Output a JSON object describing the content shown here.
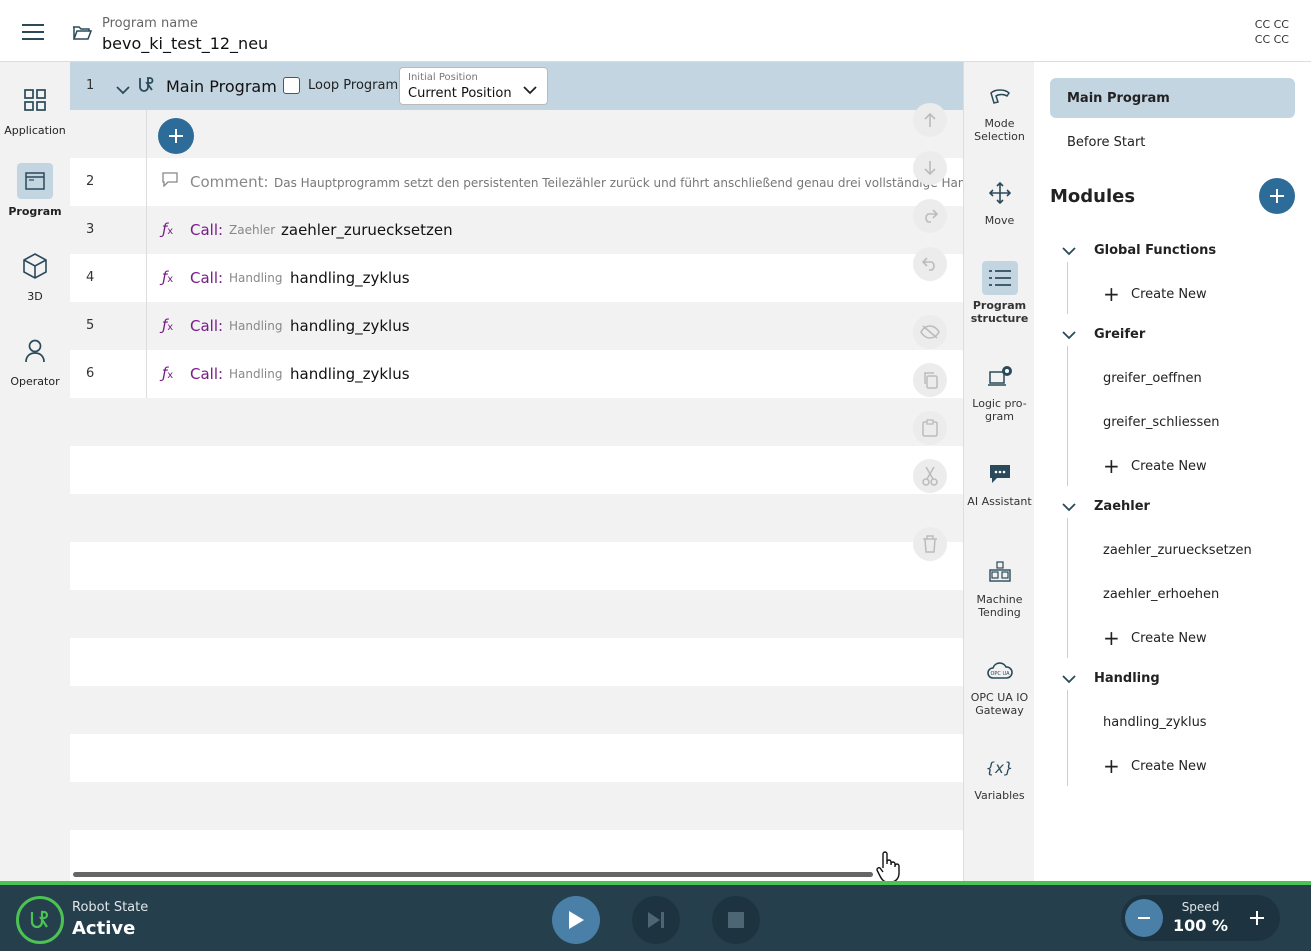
{
  "header": {
    "program_label": "Program name",
    "program_name": "bevo_ki_test_12_neu",
    "cc_top": "CC CC",
    "cc_bottom": "CC CC"
  },
  "leftnav": [
    {
      "label": "Application",
      "icon": "grid-icon"
    },
    {
      "label": "Program",
      "icon": "program-window-icon",
      "active": true
    },
    {
      "label": "3D",
      "icon": "cube-icon"
    },
    {
      "label": "Operator",
      "icon": "person-icon"
    }
  ],
  "program": {
    "row1": {
      "num": "1",
      "title": "Main Program",
      "loop_label": "Loop Program",
      "initpos_label": "Initial Position",
      "initpos_value": "Current Position"
    },
    "rows": [
      {
        "num": "2",
        "kind": "comment",
        "keyword": "Comment:",
        "text": "Das Hauptprogramm setzt den persistenten Teilezähler zurück und führt anschließend genau drei vollständige Handlin"
      },
      {
        "num": "3",
        "kind": "call",
        "keyword": "Call:",
        "module": "Zaehler",
        "func": "zaehler_zuruecksetzen"
      },
      {
        "num": "4",
        "kind": "call",
        "keyword": "Call:",
        "module": "Handling",
        "func": "handling_zyklus"
      },
      {
        "num": "5",
        "kind": "call",
        "keyword": "Call:",
        "module": "Handling",
        "func": "handling_zyklus"
      },
      {
        "num": "6",
        "kind": "call",
        "keyword": "Call:",
        "module": "Handling",
        "func": "handling_zyklus"
      }
    ]
  },
  "tools": [
    {
      "label": "Mode Selection",
      "icon": "mode-selection-icon"
    },
    {
      "label": "Move",
      "icon": "move-arrows-icon"
    },
    {
      "label": "Program structure",
      "icon": "list-icon",
      "active": true
    },
    {
      "label": "Logic pro-gram",
      "icon": "logic-program-icon"
    },
    {
      "label": "AI Assistant",
      "icon": "chat-icon"
    },
    {
      "label": "Machine Tending",
      "icon": "machine-tending-icon"
    },
    {
      "label": "OPC UA IO Gateway",
      "icon": "opcua-cloud-icon"
    },
    {
      "label": "Variables",
      "icon": "variables-icon"
    }
  ],
  "rpanel": {
    "main": "Main Program",
    "before": "Before Start",
    "modules_title": "Modules",
    "create_label": "Create New",
    "groups": [
      {
        "name": "Global Functions",
        "items": []
      },
      {
        "name": "Greifer",
        "items": [
          "greifer_oeffnen",
          "greifer_schliessen"
        ]
      },
      {
        "name": "Zaehler",
        "items": [
          "zaehler_zuruecksetzen",
          "zaehler_erhoehen"
        ]
      },
      {
        "name": "Handling",
        "items": [
          "handling_zyklus"
        ]
      }
    ]
  },
  "footer": {
    "robot_state_label": "Robot State",
    "robot_state_value": "Active",
    "speed_label": "Speed",
    "speed_value": "100 %"
  },
  "colors": {
    "accent": "#2d6b98",
    "selected": "#c4d5e2",
    "footer": "#253f4d",
    "status_green": "#4cc154",
    "keyword_purple": "#7a1a8a"
  }
}
